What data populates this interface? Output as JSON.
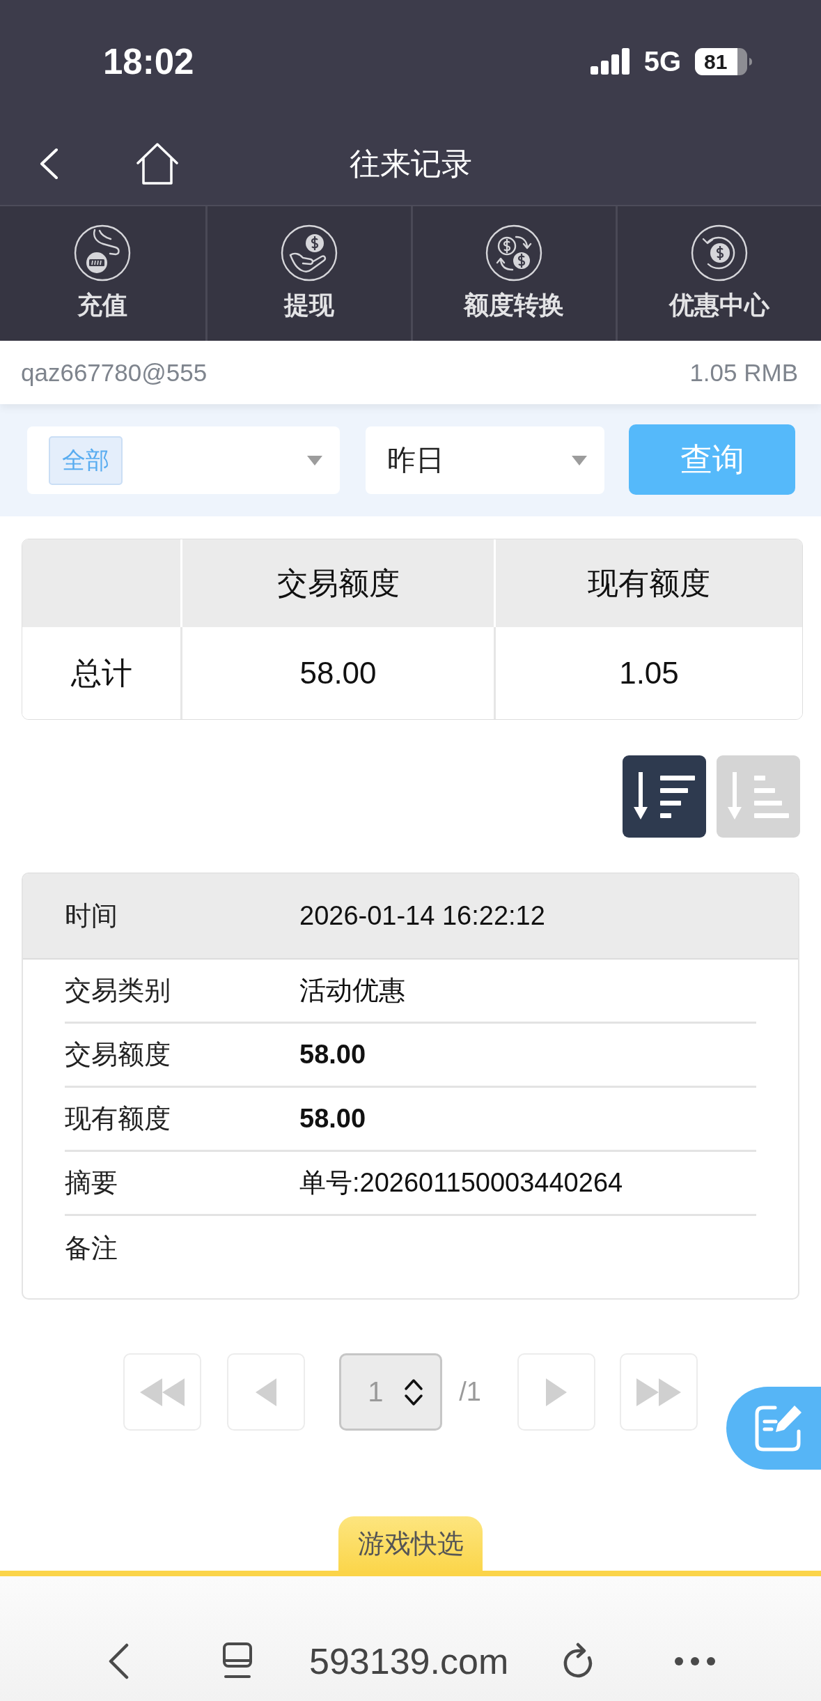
{
  "status_bar": {
    "time": "18:02",
    "network": "5G",
    "battery": "81"
  },
  "header": {
    "title": "往来记录"
  },
  "nav": [
    {
      "label": "充值"
    },
    {
      "label": "提现"
    },
    {
      "label": "额度转换"
    },
    {
      "label": "优惠中心"
    }
  ],
  "account": {
    "username": "qaz667780@555",
    "balance": "1.05 RMB"
  },
  "filters": {
    "type_select": {
      "tag": "全部"
    },
    "date_select": {
      "value": "昨日"
    },
    "query_button": "查询"
  },
  "summary_table": {
    "columns": [
      "交易额度",
      "现有额度"
    ],
    "rows": [
      {
        "label": "总计",
        "cells": [
          "58.00",
          "1.05"
        ]
      }
    ]
  },
  "sort_buttons": [
    {
      "selected": true
    },
    {
      "selected": false
    }
  ],
  "record": {
    "header": {
      "label": "时间",
      "value": "2026-01-14 16:22:12"
    },
    "rows": [
      {
        "label": "交易类别",
        "value": "活动优惠",
        "kind": "text"
      },
      {
        "label": "交易额度",
        "value": "58.00",
        "kind": "amount"
      },
      {
        "label": "现有额度",
        "value": "58.00",
        "kind": "amount"
      },
      {
        "label": "摘要",
        "value": "单号:202601150003440264",
        "kind": "text"
      },
      {
        "label": "备注"
      }
    ]
  },
  "pagination": {
    "first": {
      "disabled": true
    },
    "prev": {
      "disabled": true
    },
    "page": "1",
    "total": "/1",
    "next": {
      "disabled": true
    },
    "last": {
      "disabled": true
    }
  },
  "quick_tab": {
    "label": "游戏快选"
  },
  "browser_bar": {
    "url": "593139.com"
  }
}
